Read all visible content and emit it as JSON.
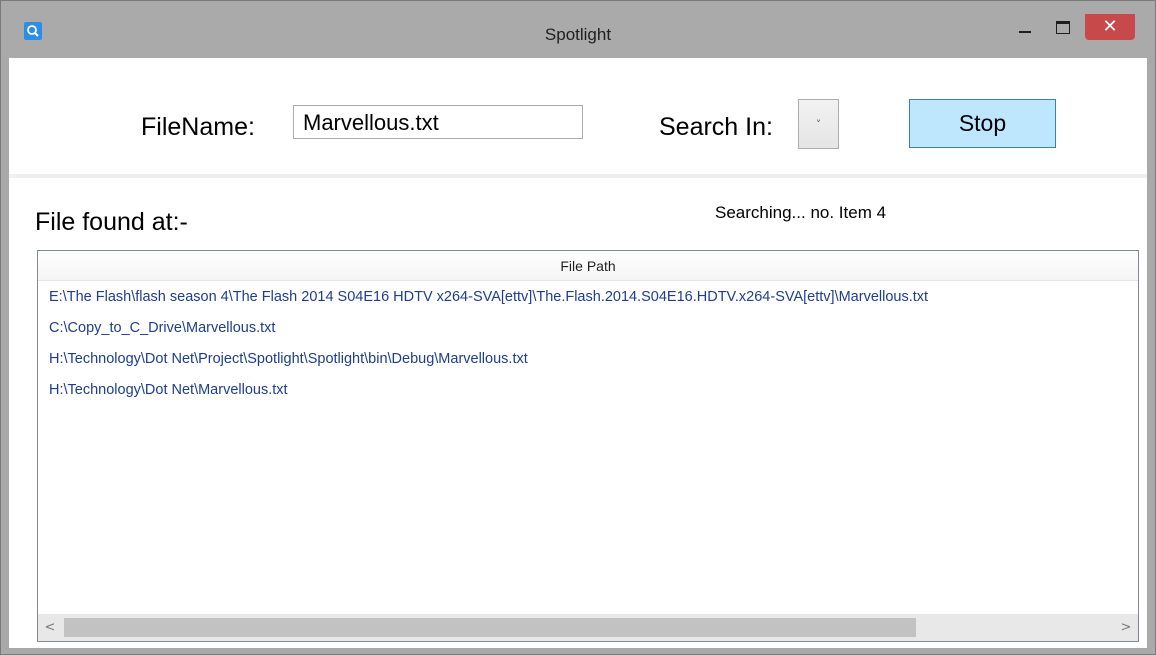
{
  "window": {
    "title": "Spotlight",
    "close_glyph": "✕"
  },
  "form": {
    "filename_label": "FileName:",
    "filename_value": "Marvellous.txt",
    "search_in_label": "Search In:",
    "search_in_value": "",
    "dropdown_glyph": "˅",
    "stop_label": "Stop"
  },
  "results": {
    "found_label": "File found at:-",
    "status": "Searching... no. Item 4",
    "column_header": "File Path",
    "rows": [
      "E:\\The Flash\\flash season 4\\The Flash 2014 S04E16 HDTV x264-SVA[ettv]\\The.Flash.2014.S04E16.HDTV.x264-SVA[ettv]\\Marvellous.txt",
      "C:\\Copy_to_C_Drive\\Marvellous.txt",
      "H:\\Technology\\Dot Net\\Project\\Spotlight\\Spotlight\\bin\\Debug\\Marvellous.txt",
      "H:\\Technology\\Dot Net\\Marvellous.txt"
    ]
  },
  "scrollbar": {
    "left_glyph": "<",
    "right_glyph": ">"
  },
  "icons": {
    "app": "search-icon",
    "minimize": "minimize-icon",
    "maximize": "maximize-icon",
    "close": "close-icon"
  },
  "colors": {
    "titlebar": "#aaaaaa",
    "close_button": "#c74949",
    "stop_button": "#bee6fd",
    "row_text": "#1e3d8f"
  }
}
